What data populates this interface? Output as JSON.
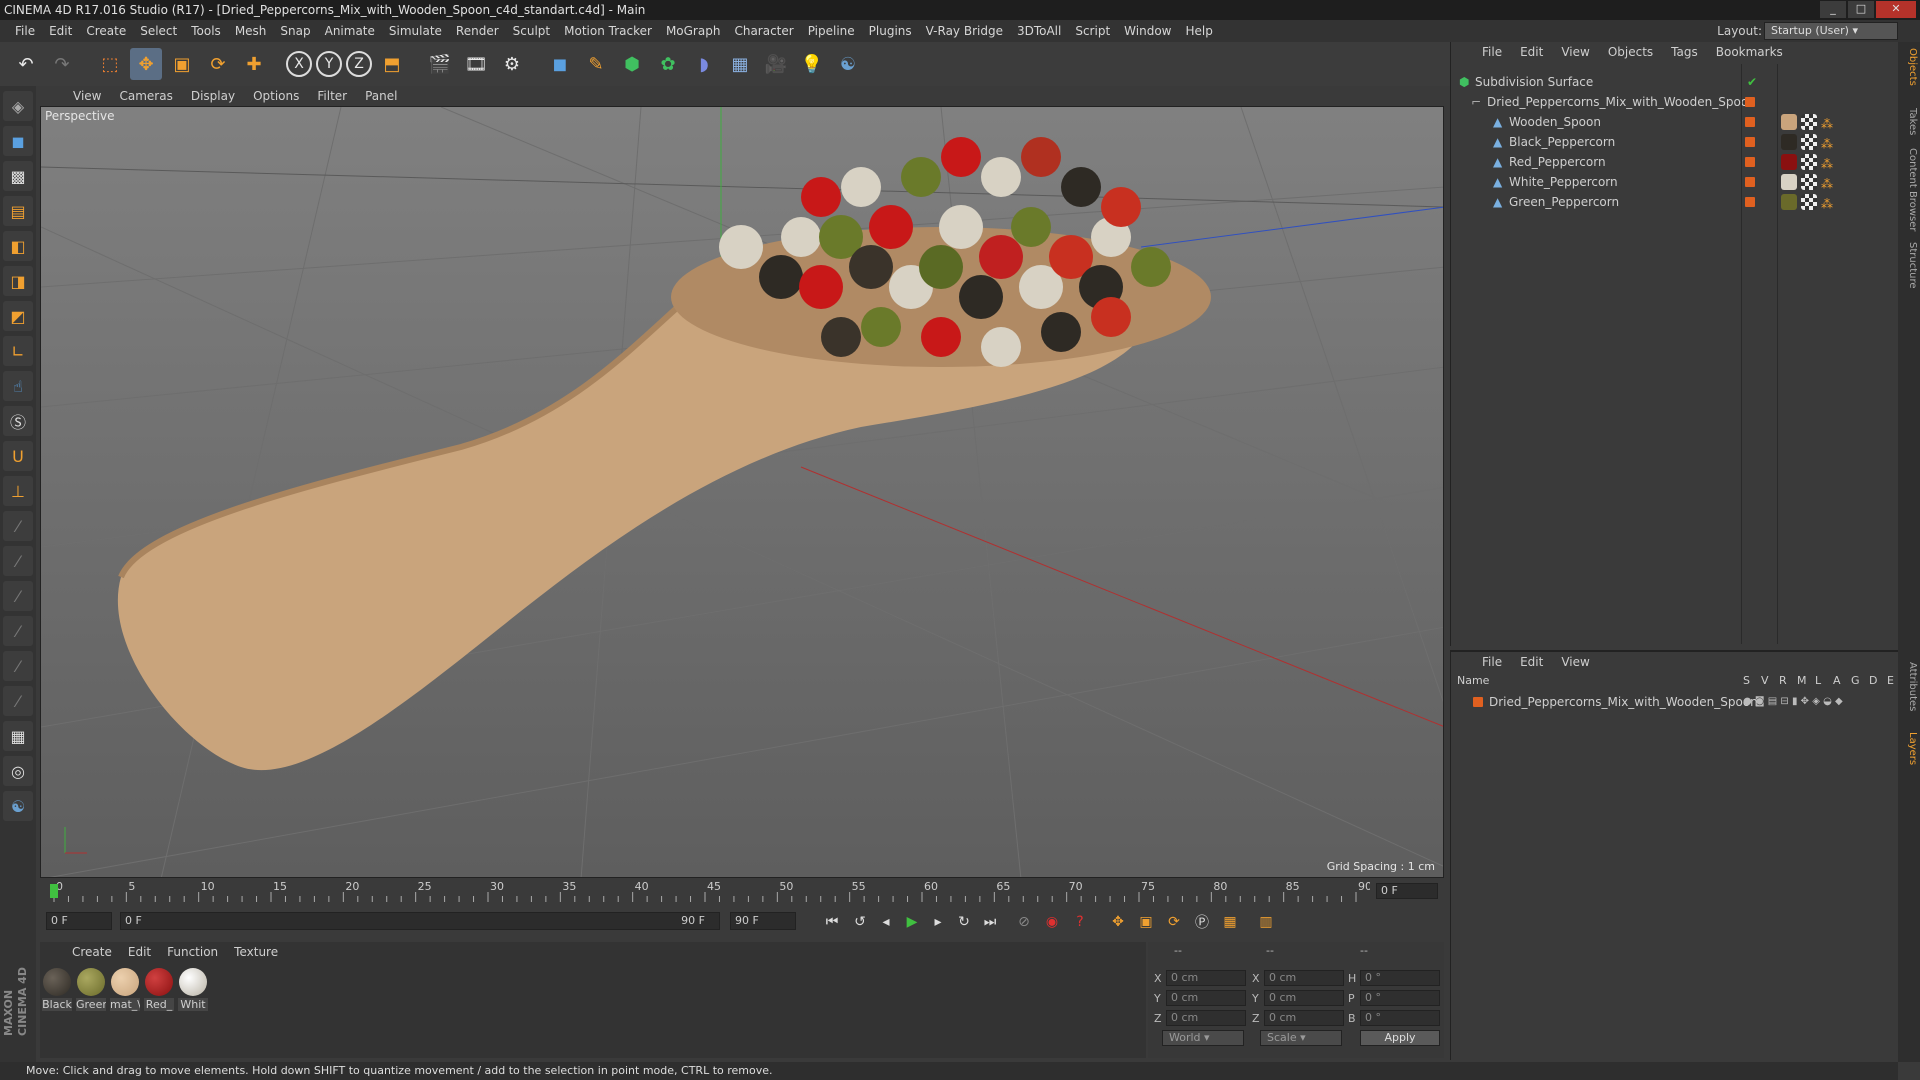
{
  "window": {
    "title": "CINEMA 4D R17.016 Studio (R17) - [Dried_Peppercorns_Mix_with_Wooden_Spoon_c4d_standart.c4d] - Main"
  },
  "menubar": {
    "items": [
      "File",
      "Edit",
      "Create",
      "Select",
      "Tools",
      "Mesh",
      "Snap",
      "Animate",
      "Simulate",
      "Render",
      "Sculpt",
      "Motion Tracker",
      "MoGraph",
      "Character",
      "Pipeline",
      "Plugins",
      "V-Ray Bridge",
      "3DToAll",
      "Script",
      "Window",
      "Help"
    ],
    "layout_label": "Layout:",
    "layout_value": "Startup (User)"
  },
  "toolbar": {
    "axis_labels": [
      "X",
      "Y",
      "Z"
    ]
  },
  "viewport": {
    "menu": [
      "View",
      "Cameras",
      "Display",
      "Options",
      "Filter",
      "Panel"
    ],
    "label": "Perspective",
    "grid_spacing": "Grid Spacing : 1 cm"
  },
  "timeline": {
    "ticks": [
      "0",
      "5",
      "10",
      "15",
      "20",
      "25",
      "30",
      "35",
      "40",
      "45",
      "50",
      "55",
      "60",
      "65",
      "70",
      "75",
      "80",
      "85",
      "90"
    ],
    "current": "0 F",
    "start": "0 F",
    "range_start": "0 F",
    "range_end": "90 F",
    "end": "90 F"
  },
  "materials": {
    "menu": [
      "Create",
      "Edit",
      "Function",
      "Texture"
    ],
    "items": [
      {
        "label": "Black",
        "color": "#2e2a24"
      },
      {
        "label": "Greer",
        "color": "#6a6a2a"
      },
      {
        "label": "mat_\\",
        "color": "#c9a47c"
      },
      {
        "label": "Red_",
        "color": "#8a1010"
      },
      {
        "label": "Whit",
        "color": "#d8d2c4"
      }
    ]
  },
  "coords": {
    "header": [
      "--",
      "--",
      "--"
    ],
    "rows": [
      {
        "a": "X",
        "av": "0 cm",
        "b": "X",
        "bv": "0 cm",
        "c": "H",
        "cv": "0 °"
      },
      {
        "a": "Y",
        "av": "0 cm",
        "b": "Y",
        "bv": "0 cm",
        "c": "P",
        "cv": "0 °"
      },
      {
        "a": "Z",
        "av": "0 cm",
        "b": "Z",
        "bv": "0 cm",
        "c": "B",
        "cv": "0 °"
      }
    ],
    "world": "World",
    "scale": "Scale",
    "apply": "Apply"
  },
  "status": "Move: Click and drag to move elements. Hold down SHIFT to quantize movement / add to the selection in point mode, CTRL to remove.",
  "objects": {
    "menu": [
      "File",
      "Edit",
      "View",
      "Objects",
      "Tags",
      "Bookmarks"
    ],
    "items": [
      {
        "name": "Subdivision Surface"
      },
      {
        "name": "Dried_Peppercorns_Mix_with_Wooden_Spoon"
      },
      {
        "name": "Wooden_Spoon"
      },
      {
        "name": "Black_Peppercorn"
      },
      {
        "name": "Red_Peppercorn"
      },
      {
        "name": "White_Peppercorn"
      },
      {
        "name": "Green_Peppercorn"
      }
    ]
  },
  "layers": {
    "menu": [
      "File",
      "Edit",
      "View"
    ],
    "name_header": "Name",
    "cols": [
      "S",
      "V",
      "R",
      "M",
      "L",
      "A",
      "G",
      "D",
      "E"
    ],
    "items": [
      {
        "name": "Dried_Peppercorns_Mix_with_Wooden_Spoon"
      }
    ]
  },
  "rightstrip": [
    "Objects",
    "Takes",
    "Content Browser",
    "Structure",
    "Attributes",
    "Layers"
  ],
  "brand": "MAXON CINEMA 4D"
}
